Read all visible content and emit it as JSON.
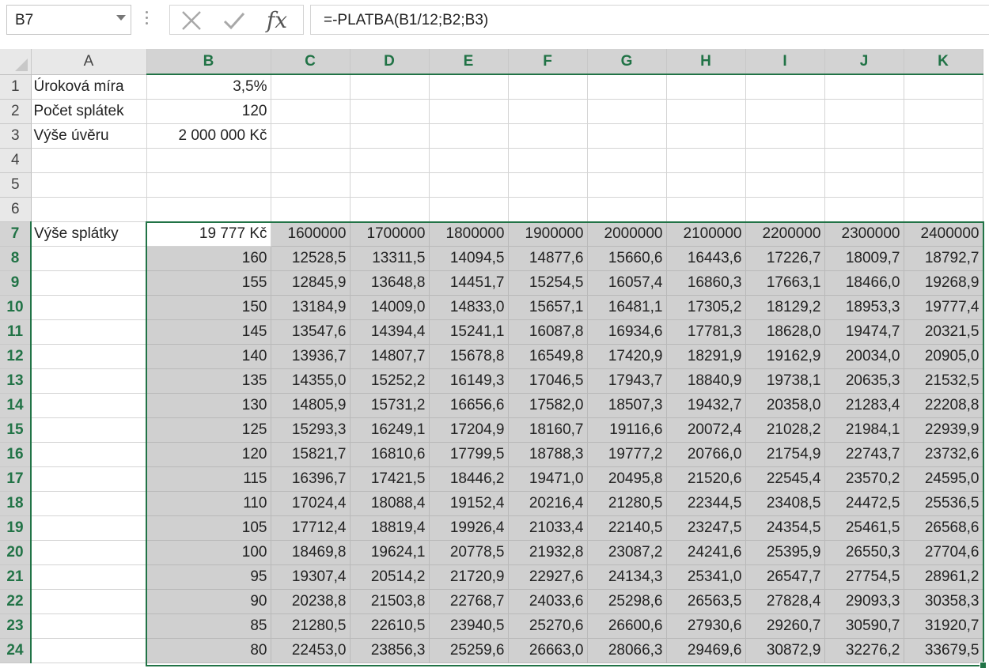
{
  "name_box": {
    "value": "B7"
  },
  "formula_bar": {
    "fx_label": "fx",
    "formula": "=-PLATBA(B1/12;B2;B3)"
  },
  "columns": [
    "A",
    "B",
    "C",
    "D",
    "E",
    "F",
    "G",
    "H",
    "I",
    "J",
    "K"
  ],
  "selected_columns": [
    "B",
    "C",
    "D",
    "E",
    "F",
    "G",
    "H",
    "I",
    "J",
    "K"
  ],
  "selected_rows_from": 7,
  "selected_rows_to": 24,
  "accent_color": "#217346",
  "rows": [
    {
      "n": "1",
      "a": "Úroková míra",
      "b": "3,5%",
      "cells": [
        "",
        "",
        "",
        "",
        "",
        "",
        "",
        "",
        ""
      ]
    },
    {
      "n": "2",
      "a": "Počet splátek",
      "b": "120",
      "cells": [
        "",
        "",
        "",
        "",
        "",
        "",
        "",
        "",
        ""
      ]
    },
    {
      "n": "3",
      "a": "Výše úvěru",
      "b": "2 000 000 Kč",
      "cells": [
        "",
        "",
        "",
        "",
        "",
        "",
        "",
        "",
        ""
      ]
    },
    {
      "n": "4",
      "a": "",
      "b": "",
      "cells": [
        "",
        "",
        "",
        "",
        "",
        "",
        "",
        "",
        ""
      ]
    },
    {
      "n": "5",
      "a": "",
      "b": "",
      "cells": [
        "",
        "",
        "",
        "",
        "",
        "",
        "",
        "",
        ""
      ]
    },
    {
      "n": "6",
      "a": "",
      "b": "",
      "cells": [
        "",
        "",
        "",
        "",
        "",
        "",
        "",
        "",
        ""
      ]
    },
    {
      "n": "7",
      "a": "Výše splátky",
      "b": "19 777 Kč",
      "cells": [
        "1600000",
        "1700000",
        "1800000",
        "1900000",
        "2000000",
        "2100000",
        "2200000",
        "2300000",
        "2400000"
      ]
    },
    {
      "n": "8",
      "a": "",
      "b": "160",
      "cells": [
        "12528,5",
        "13311,5",
        "14094,5",
        "14877,6",
        "15660,6",
        "16443,6",
        "17226,7",
        "18009,7",
        "18792,7"
      ]
    },
    {
      "n": "9",
      "a": "",
      "b": "155",
      "cells": [
        "12845,9",
        "13648,8",
        "14451,7",
        "15254,5",
        "16057,4",
        "16860,3",
        "17663,1",
        "18466,0",
        "19268,9"
      ]
    },
    {
      "n": "10",
      "a": "",
      "b": "150",
      "cells": [
        "13184,9",
        "14009,0",
        "14833,0",
        "15657,1",
        "16481,1",
        "17305,2",
        "18129,2",
        "18953,3",
        "19777,4"
      ]
    },
    {
      "n": "11",
      "a": "",
      "b": "145",
      "cells": [
        "13547,6",
        "14394,4",
        "15241,1",
        "16087,8",
        "16934,6",
        "17781,3",
        "18628,0",
        "19474,7",
        "20321,5"
      ]
    },
    {
      "n": "12",
      "a": "",
      "b": "140",
      "cells": [
        "13936,7",
        "14807,7",
        "15678,8",
        "16549,8",
        "17420,9",
        "18291,9",
        "19162,9",
        "20034,0",
        "20905,0"
      ]
    },
    {
      "n": "13",
      "a": "",
      "b": "135",
      "cells": [
        "14355,0",
        "15252,2",
        "16149,3",
        "17046,5",
        "17943,7",
        "18840,9",
        "19738,1",
        "20635,3",
        "21532,5"
      ]
    },
    {
      "n": "14",
      "a": "",
      "b": "130",
      "cells": [
        "14805,9",
        "15731,2",
        "16656,6",
        "17582,0",
        "18507,3",
        "19432,7",
        "20358,0",
        "21283,4",
        "22208,8"
      ]
    },
    {
      "n": "15",
      "a": "",
      "b": "125",
      "cells": [
        "15293,3",
        "16249,1",
        "17204,9",
        "18160,7",
        "19116,6",
        "20072,4",
        "21028,2",
        "21984,1",
        "22939,9"
      ]
    },
    {
      "n": "16",
      "a": "",
      "b": "120",
      "cells": [
        "15821,7",
        "16810,6",
        "17799,5",
        "18788,3",
        "19777,2",
        "20766,0",
        "21754,9",
        "22743,7",
        "23732,6"
      ]
    },
    {
      "n": "17",
      "a": "",
      "b": "115",
      "cells": [
        "16396,7",
        "17421,5",
        "18446,2",
        "19471,0",
        "20495,8",
        "21520,6",
        "22545,4",
        "23570,2",
        "24595,0"
      ]
    },
    {
      "n": "18",
      "a": "",
      "b": "110",
      "cells": [
        "17024,4",
        "18088,4",
        "19152,4",
        "20216,4",
        "21280,5",
        "22344,5",
        "23408,5",
        "24472,5",
        "25536,5"
      ]
    },
    {
      "n": "19",
      "a": "",
      "b": "105",
      "cells": [
        "17712,4",
        "18819,4",
        "19926,4",
        "21033,4",
        "22140,5",
        "23247,5",
        "24354,5",
        "25461,5",
        "26568,6"
      ]
    },
    {
      "n": "20",
      "a": "",
      "b": "100",
      "cells": [
        "18469,8",
        "19624,1",
        "20778,5",
        "21932,8",
        "23087,2",
        "24241,6",
        "25395,9",
        "26550,3",
        "27704,6"
      ]
    },
    {
      "n": "21",
      "a": "",
      "b": "95",
      "cells": [
        "19307,4",
        "20514,2",
        "21720,9",
        "22927,6",
        "24134,3",
        "25341,0",
        "26547,7",
        "27754,5",
        "28961,2"
      ]
    },
    {
      "n": "22",
      "a": "",
      "b": "90",
      "cells": [
        "20238,8",
        "21503,8",
        "22768,7",
        "24033,6",
        "25298,6",
        "26563,5",
        "27828,4",
        "29093,3",
        "30358,3"
      ]
    },
    {
      "n": "23",
      "a": "",
      "b": "85",
      "cells": [
        "21280,5",
        "22610,5",
        "23940,5",
        "25270,6",
        "26600,6",
        "27930,6",
        "29260,7",
        "30590,7",
        "31920,7"
      ]
    },
    {
      "n": "24",
      "a": "",
      "b": "80",
      "cells": [
        "22453,0",
        "23856,3",
        "25259,6",
        "26663,0",
        "28066,3",
        "29469,6",
        "30872,9",
        "32276,2",
        "33679,5"
      ]
    }
  ]
}
